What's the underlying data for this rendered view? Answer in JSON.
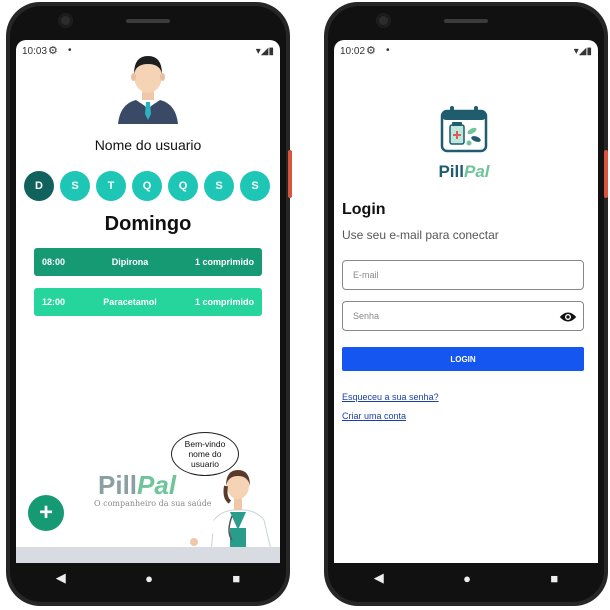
{
  "left_phone": {
    "status": {
      "time": "10:03",
      "gear": "⚙",
      "dot": "•",
      "right": "▾◢▮"
    },
    "username": "Nome do usuario",
    "days": [
      {
        "label": "D",
        "active": true
      },
      {
        "label": "S",
        "active": false
      },
      {
        "label": "T",
        "active": false
      },
      {
        "label": "Q",
        "active": false
      },
      {
        "label": "Q",
        "active": false
      },
      {
        "label": "S",
        "active": false
      },
      {
        "label": "S",
        "active": false
      }
    ],
    "day_name": "Domingo",
    "medications": [
      {
        "time": "08:00",
        "name": "Dipirona",
        "dose": "1 comprimido"
      },
      {
        "time": "12:00",
        "name": "Paracetamol",
        "dose": "1 comprimido"
      }
    ],
    "fab_label": "+",
    "logo": {
      "part1": "Pill",
      "part2": "Pal",
      "tagline": "O companheiro da sua saúde"
    },
    "bubble": {
      "line1": "Bem-vindo",
      "line2": "nome do",
      "line3": "usuario"
    }
  },
  "right_phone": {
    "status": {
      "time": "10:02",
      "gear": "⚙",
      "dot": "•",
      "right": "▾◢▮"
    },
    "logo": {
      "part1": "Pill",
      "part2": "Pal"
    },
    "title": "Login",
    "subtitle": "Use seu e-mail para conectar",
    "email_placeholder": "E-mail",
    "password_placeholder": "Senha",
    "login_button": "LOGIN",
    "forgot_link": "Esqueceu a sua senha?",
    "create_link": "Criar uma conta"
  },
  "navbar": {
    "back": "◀",
    "home": "●",
    "recent": "■"
  },
  "colors": {
    "teal_active": "#11625c",
    "teal": "#1ec7b5",
    "card_dark": "#169a74",
    "card_light": "#25d59b",
    "login_blue": "#1556f0"
  }
}
